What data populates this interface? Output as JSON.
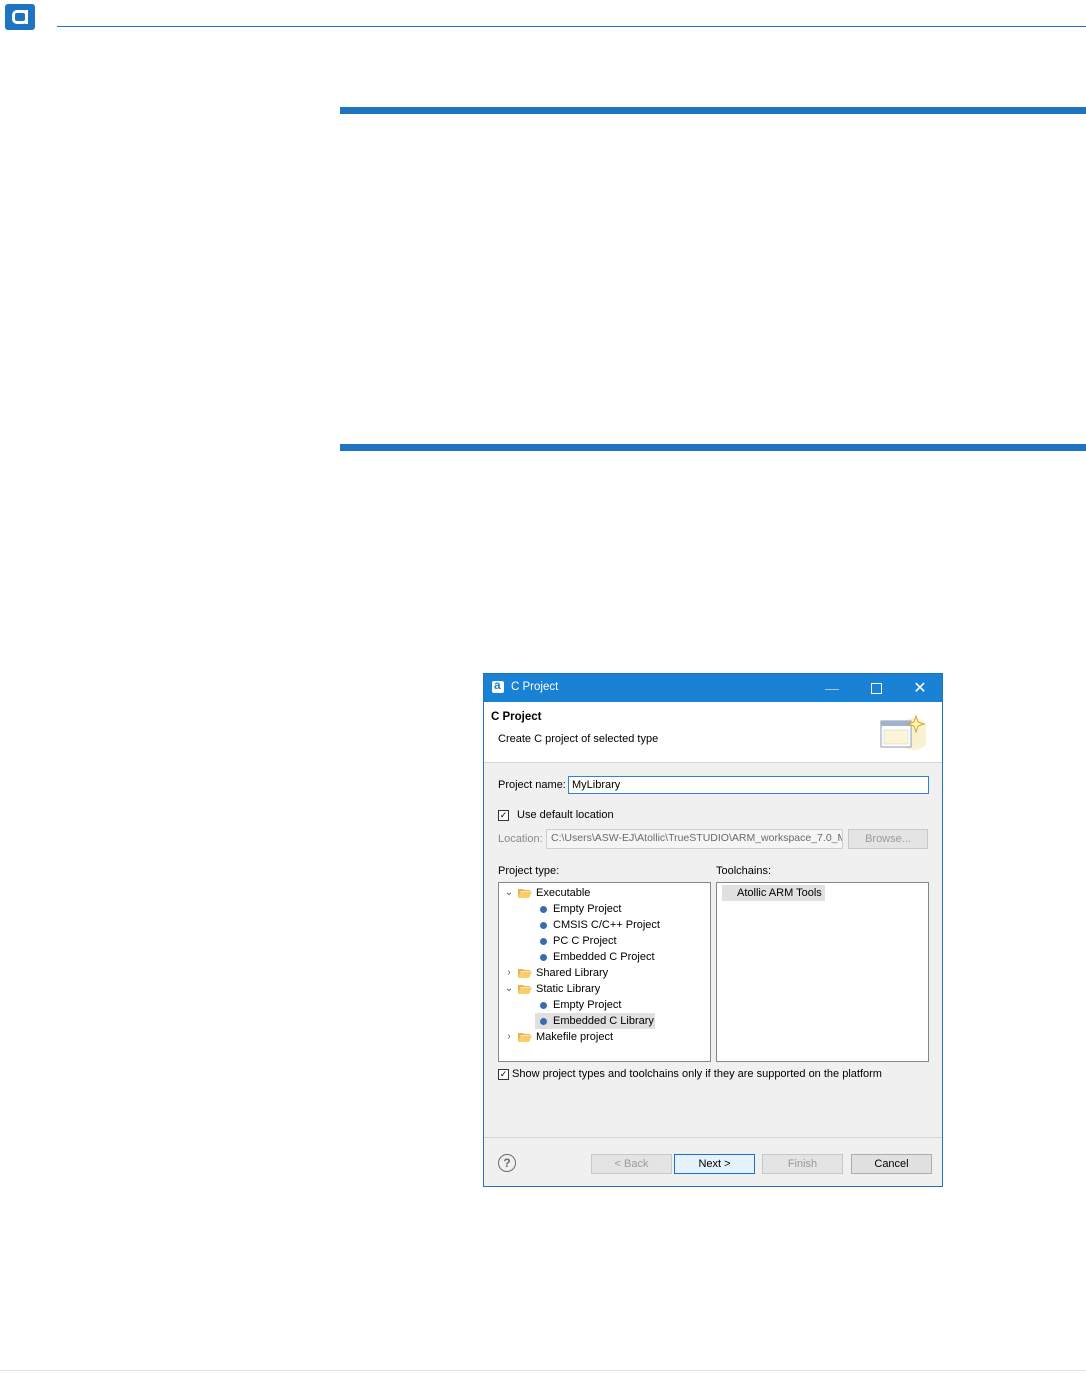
{
  "dialog": {
    "title": "C Project",
    "window_controls": {
      "minimize": "—",
      "maximize": "maximize-icon",
      "close": "✕"
    },
    "banner_title": "C Project",
    "banner_description": "Create C project of selected type",
    "project_name_label": "Project name:",
    "project_name_value": "MyLibrary",
    "use_default_location_label": "Use default location",
    "use_default_location_checked": true,
    "location_label": "Location:",
    "location_value": "C:\\Users\\ASW-EJ\\Atollic\\TrueSTUDIO\\ARM_workspace_7.0_M",
    "browse_label": "Browse...",
    "project_type_label": "Project type:",
    "toolchains_label": "Toolchains:",
    "project_types": [
      {
        "label": "Executable",
        "kind": "folder",
        "expanded": true
      },
      {
        "label": "Empty Project",
        "kind": "leaf"
      },
      {
        "label": "CMSIS C/C++ Project",
        "kind": "leaf"
      },
      {
        "label": "PC C Project",
        "kind": "leaf"
      },
      {
        "label": "Embedded C Project",
        "kind": "leaf"
      },
      {
        "label": "Shared Library",
        "kind": "folder",
        "expanded": false
      },
      {
        "label": "Static Library",
        "kind": "folder",
        "expanded": true
      },
      {
        "label": "Empty Project",
        "kind": "leaf"
      },
      {
        "label": "Embedded C Library",
        "kind": "leaf",
        "selected": true
      },
      {
        "label": "Makefile project",
        "kind": "folder",
        "expanded": false
      }
    ],
    "toolchains": [
      "Atollic ARM Tools"
    ],
    "show_supported_label": "Show project types and toolchains only if they are supported on the platform",
    "show_supported_checked": true,
    "help_icon": "?",
    "buttons": {
      "back": "< Back",
      "next": "Next >",
      "finish": "Finish",
      "cancel": "Cancel"
    }
  },
  "colors": {
    "accent": "#1e74c2",
    "titlebar": "#1a82d4",
    "dialog_bg": "#f0f0f0"
  }
}
